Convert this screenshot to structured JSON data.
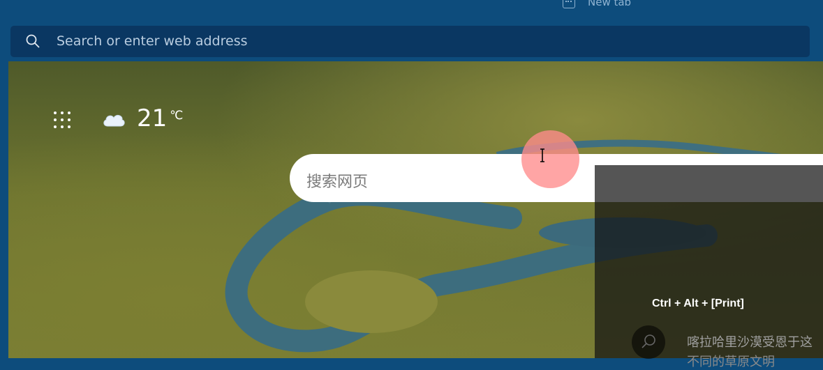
{
  "browser": {
    "tab_label": "New tab",
    "address_placeholder": "Search or enter web address"
  },
  "newtab_page": {
    "weather": {
      "temperature": "21",
      "unit": "℃",
      "condition_icon": "cloud-icon"
    },
    "search_placeholder": "搜索网页",
    "overlay": {
      "shortcut_hint": "Ctrl + Alt +  [Print]",
      "news_line_1": "喀拉哈里沙漠受恩于这",
      "news_line_2": "不同的草原文明"
    }
  },
  "colors": {
    "chrome": "#0d4c7c",
    "address_bar": "#0a3762",
    "cursor_highlight": "#ff8c8c"
  }
}
